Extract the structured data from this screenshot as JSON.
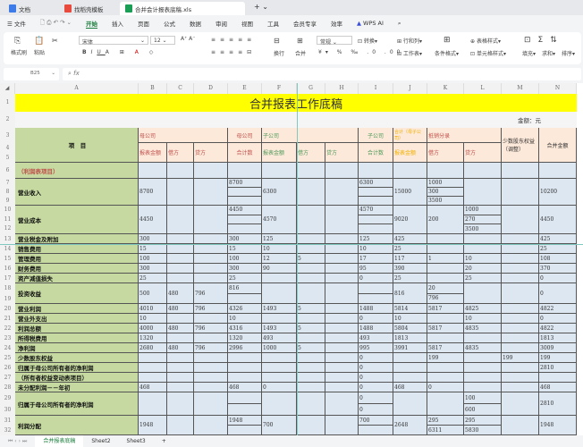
{
  "tabs": [
    {
      "label": "文档",
      "icon": "doc-icon",
      "color": "#3d7ce8"
    },
    {
      "label": "找稻壳模板",
      "icon": "docer-icon",
      "color": "#e84a3d"
    },
    {
      "label": "合并会计报表底稿.xls",
      "icon": "sheet-icon",
      "color": "#1a9e55"
    }
  ],
  "menu": {
    "file": "文件",
    "items": [
      "开始",
      "插入",
      "页面",
      "公式",
      "数据",
      "审阅",
      "视图",
      "工具",
      "会员专享",
      "效率"
    ],
    "ai": "WPS AI"
  },
  "ribbon": {
    "format_painter": "格式刷",
    "paste": "粘贴",
    "font": "宋体",
    "size": "12",
    "wrap": "换行",
    "merge": "合并",
    "number_format": "常规",
    "convert": "转换",
    "rowcol": "行和列",
    "worksheet": "工作表",
    "cond_format": "条件格式",
    "table_style": "表格样式",
    "cell_style": "单元格样式",
    "fill": "填充",
    "sum": "求和",
    "sort": "排序"
  },
  "formula_bar": {
    "cell_ref": "B25",
    "fx": "fx",
    "value": ""
  },
  "columns": [
    "A",
    "B",
    "C",
    "D",
    "E",
    "F",
    "G",
    "H",
    "I",
    "J",
    "K",
    "L",
    "M",
    "N"
  ],
  "title": "合并报表工作底稿",
  "unit": "金额：元",
  "header": {
    "item": "项　目",
    "parent": "母公司",
    "report_amount": "报表金额",
    "debit": "借方",
    "credit": "贷方",
    "parent_total": "母公司",
    "total": "合计数",
    "sub": "子公司",
    "sub_report": "报表金额",
    "sub_debit": "借方",
    "sub_credit": "贷方",
    "sub_total_top": "子公司",
    "sub_total": "合计数",
    "sum_top": "合计（母子公司）",
    "sum_report": "报表金额",
    "elim": "抵销分录",
    "elim_debit": "借方",
    "elim_credit": "贷方",
    "minority": "少数股东权益（调整）",
    "consolidated": "合并金额"
  },
  "rows": [
    {
      "nums": [
        "6"
      ],
      "label": "（利润表项目）",
      "red": true,
      "cells": {}
    },
    {
      "nums": [
        "7",
        "8",
        "9"
      ],
      "label": "营业收入",
      "cells": {
        "B": "8700",
        "E": [
          "8700",
          "",
          ""
        ],
        "F": "6300",
        "I": [
          "6300",
          "",
          ""
        ],
        "J": "15000",
        "K": [
          "1000",
          "300",
          "3500"
        ],
        "N": "10200"
      }
    },
    {
      "nums": [
        "10",
        "11",
        "12"
      ],
      "label": "营业成本",
      "cells": {
        "B": "4450",
        "E": [
          "4450",
          "",
          ""
        ],
        "F": "4570",
        "I": [
          "4570",
          "",
          ""
        ],
        "J": "9020",
        "K": "200",
        "L": [
          "1000",
          "270",
          "3500"
        ],
        "N": "4450"
      }
    },
    {
      "nums": [
        "13"
      ],
      "label": "营业税金及附加",
      "cells": {
        "B": "300",
        "E": "300",
        "F": "125",
        "I": "125",
        "J": "425",
        "N": "425"
      }
    },
    {
      "nums": [
        "14"
      ],
      "label": "销售费用",
      "cells": {
        "B": "15",
        "E": "15",
        "F": "10",
        "I": "10",
        "J": "25",
        "N": "25"
      }
    },
    {
      "nums": [
        "15"
      ],
      "label": "管理费用",
      "cells": {
        "B": "100",
        "E": "100",
        "F": "12",
        "G": "5",
        "I": "17",
        "J": "117",
        "K": "1",
        "L": "10",
        "N": "108"
      }
    },
    {
      "nums": [
        "16"
      ],
      "label": "财务费用",
      "cells": {
        "B": "300",
        "E": "300",
        "F": "90",
        "I": "95",
        "J": "390",
        "L": "20",
        "N": "370"
      }
    },
    {
      "nums": [
        "17"
      ],
      "label": "资产减值损失",
      "cells": {
        "B": "25",
        "E": "25",
        "I": "0",
        "J": "25",
        "L": "25",
        "N": "0"
      }
    },
    {
      "nums": [
        "18",
        "19"
      ],
      "label": "投资收益",
      "cells": {
        "B": "500",
        "C": "480",
        "D": "796",
        "E": [
          "816",
          ""
        ],
        "I": [
          "",
          ""
        ],
        "J": "816",
        "K": [
          "20",
          "796"
        ],
        "N": "0"
      }
    },
    {
      "nums": [
        "20"
      ],
      "label": "营业利润",
      "cells": {
        "B": "4010",
        "C": "480",
        "D": "796",
        "E": "4326",
        "F": "1493",
        "G": "5",
        "I": "1488",
        "J": "5814",
        "K": "5817",
        "L": "4825",
        "N": "4822"
      }
    },
    {
      "nums": [
        "21"
      ],
      "label": "营业外支出",
      "cells": {
        "B": "10",
        "E": "10",
        "I": "0",
        "J": "10",
        "L": "10",
        "N": "0"
      }
    },
    {
      "nums": [
        "22"
      ],
      "label": "利润总额",
      "cells": {
        "B": "4000",
        "C": "480",
        "D": "796",
        "E": "4316",
        "F": "1493",
        "G": "5",
        "I": "1488",
        "J": "5804",
        "K": "5817",
        "L": "4835",
        "N": "4822"
      }
    },
    {
      "nums": [
        "23"
      ],
      "label": "所得税费用",
      "cells": {
        "B": "1320",
        "E": "1320",
        "F": "493",
        "I": "493",
        "J": "1813",
        "N": "1813"
      }
    },
    {
      "nums": [
        "24"
      ],
      "label": "净利润",
      "cells": {
        "B": "2680",
        "C": "480",
        "D": "796",
        "E": "2996",
        "F": "1000",
        "G": "5",
        "I": "995",
        "J": "3991",
        "K": "5817",
        "L": "4835",
        "N": "3009"
      }
    },
    {
      "nums": [
        "25"
      ],
      "label": "少数股东权益",
      "cells": {
        "I": "0",
        "K": "199",
        "M": "199",
        "N": "199"
      }
    },
    {
      "nums": [
        "26"
      ],
      "label": "归属于母公司所有者的净利润",
      "cells": {
        "I": "0",
        "N": "2810"
      }
    },
    {
      "nums": [
        "27"
      ],
      "label": "（所有者权益变动表项目）",
      "cells": {
        "I": "0"
      }
    },
    {
      "nums": [
        "28"
      ],
      "label": "未分配利润－－年初",
      "cells": {
        "B": "468",
        "E": "468",
        "F": "0",
        "I": "0",
        "J": "468",
        "K": "0",
        "N": "468"
      }
    },
    {
      "nums": [
        "29",
        "30"
      ],
      "label": "归属于母公司所有者的净利润",
      "cells": {
        "E": [
          "",
          ""
        ],
        "I": [
          "0",
          "0"
        ],
        "L": [
          "100",
          "600"
        ],
        "N": "2810"
      }
    },
    {
      "nums": [
        "31",
        "32"
      ],
      "label": "利润分配",
      "cells": {
        "B": "1948",
        "E": [
          "1948",
          ""
        ],
        "F": "700",
        "I": [
          "700",
          ""
        ],
        "J": "2648",
        "K": [
          "295",
          "6311"
        ],
        "L": [
          "295",
          "5830"
        ],
        "N": "1948"
      }
    }
  ],
  "sheets": [
    "合并报表底稿",
    "Sheet2",
    "Sheet3"
  ],
  "colors": {
    "label_bg": "#c5d9a0",
    "data_bg": "#dde7f1",
    "header_bg": "#fde9d9",
    "title_bg": "#ffff00",
    "accent": "#1a7f3c"
  }
}
